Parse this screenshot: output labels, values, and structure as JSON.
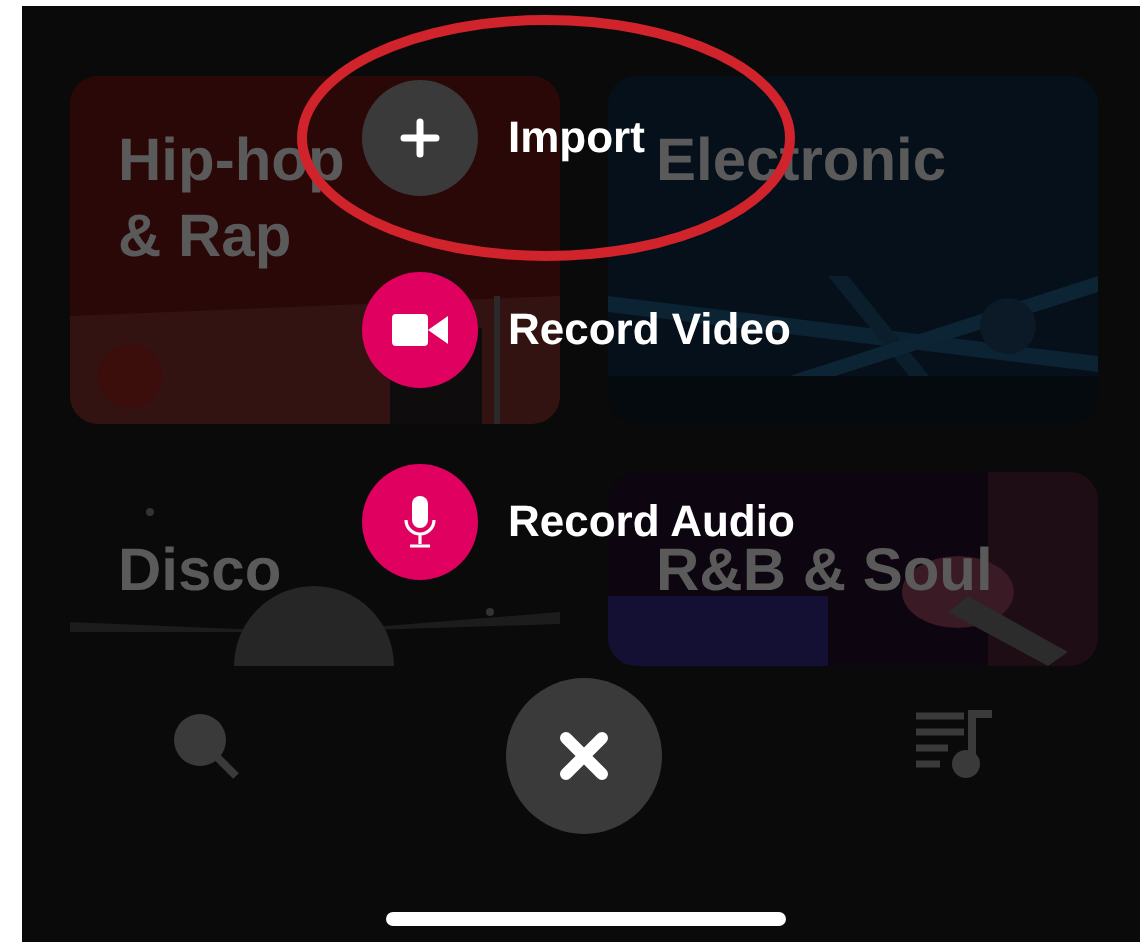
{
  "genres": [
    {
      "label": "Hip-hop & Rap",
      "kind": "picture"
    },
    {
      "label": "Electronic",
      "kind": "picture"
    },
    {
      "label": "Disco",
      "kind": "picture"
    },
    {
      "label": "R&B & Soul",
      "kind": "picture"
    }
  ],
  "actions": [
    {
      "label": "Import",
      "highlighted": true
    },
    {
      "label": "Record Video",
      "highlighted": false
    },
    {
      "label": "Record Audio",
      "highlighted": false
    }
  ]
}
